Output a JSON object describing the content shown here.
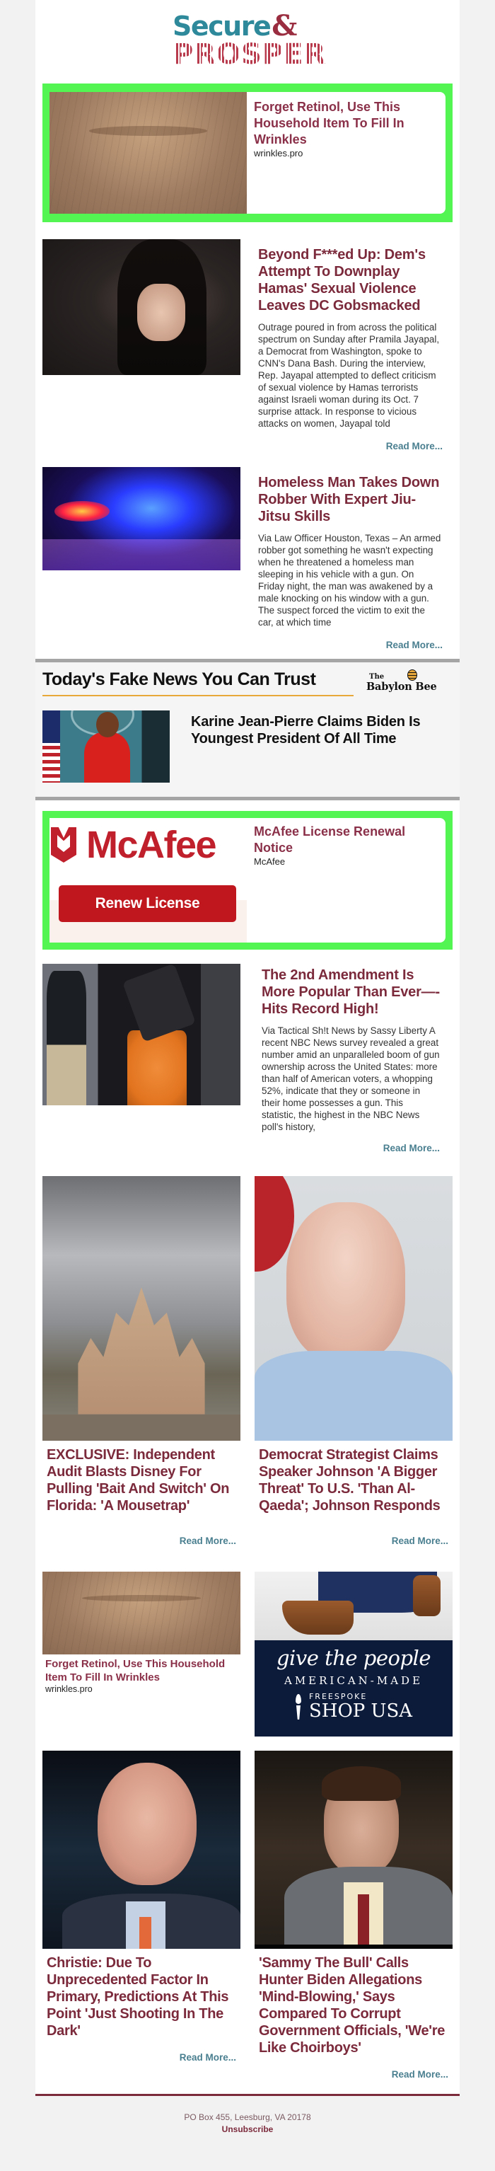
{
  "header": {
    "logo_top": "Secure",
    "logo_amp": "&",
    "logo_bottom": "PROSPER"
  },
  "ad_top": {
    "title": "Forget Retinol, Use This Household Item To Fill In Wrinkles",
    "source": "wrinkles.pro"
  },
  "articles": [
    {
      "title": "Beyond F***ed Up: Dem's Attempt To Downplay Hamas' Sexual Violence Leaves DC Gobsmacked",
      "excerpt": "Outrage poured in from across the political spectrum on Sunday after Pramila Jayapal, a Democrat from Washington, spoke to CNN's Dana Bash. During the interview, Rep. Jayapal attempted to deflect criticism of sexual violence by Hamas terrorists against Israeli woman during its Oct. 7 surprise attack. In response to vicious attacks on women, Jayapal told",
      "read_more": "Read More..."
    },
    {
      "title": "Homeless Man Takes Down Robber With Expert Jiu-Jitsu Skills",
      "excerpt": "Via Law Officer Houston, Texas – An armed robber got something he wasn't expecting when he threatened a homeless man sleeping in his vehicle with a gun. On Friday night, the man was awakened by a male knocking on his window with a gun. The suspect forced the victim to exit the car, at which time",
      "read_more": "Read More..."
    }
  ],
  "babylon_bee": {
    "section_title": "Today's Fake News You Can Trust",
    "logo_the": "The",
    "logo_name": "Babylon Bee",
    "story_title": "Karine Jean-Pierre Claims Biden Is Youngest President Of All Time"
  },
  "ad_mcafee": {
    "logo_word": "McAfee",
    "button_label": "Renew License",
    "title": "McAfee License Renewal Notice",
    "source": "McAfee"
  },
  "article_gun": {
    "title": "The 2nd Amendment Is More Popular Than Ever—-Hits Record High!",
    "excerpt": "Via Tactical Sh!t News by Sassy Liberty A recent NBC News survey revealed a great number amid an unparalleled boom of gun ownership across the United States: more than half of American voters, a whopping 52%, indicate that they or someone in their home possesses a gun. This statistic, the highest in the NBC News poll's history,",
    "read_more": "Read More..."
  },
  "grid_1": [
    {
      "title": "EXCLUSIVE: Independent Audit Blasts Disney For Pulling 'Bait And Switch' On Florida: 'A Mousetrap'",
      "read_more": "Read More..."
    },
    {
      "title": "Democrat Strategist Claims Speaker Johnson 'A Bigger Threat' To U.S. 'Than Al-Qaeda'; Johnson Responds",
      "read_more": "Read More..."
    }
  ],
  "grid_ads": {
    "wrinkle": {
      "title": "Forget Retinol, Use This Household Item To Fill In Wrinkles",
      "source": "wrinkles.pro"
    },
    "freespoke": {
      "tagline": "give the people",
      "made": "AMERICAN-MADE",
      "brand_small": "FREESPOKE",
      "brand_large": "SHOP USA"
    }
  },
  "grid_2": [
    {
      "title": "Christie: Due To Unprecedented Factor In Primary, Predictions At This Point 'Just Shooting In The Dark'",
      "read_more": "Read More..."
    },
    {
      "title": "'Sammy The Bull' Calls Hunter Biden Allegations 'Mind-Blowing,' Says Compared To Corrupt Government Officials, 'We're Like Choirboys'",
      "read_more": "Read More..."
    }
  ],
  "footer": {
    "address": "PO Box 455, Leesburg, VA 20178",
    "unsubscribe": "Unsubscribe"
  },
  "colors": {
    "headline": "#7b2a3c",
    "read_more": "#4a7f90",
    "ad_border": "#52f552",
    "brand_teal": "#2e8a9a",
    "brand_red": "#9a2e40",
    "bee_underline": "#e9a83a",
    "mcafee_red": "#c0161e",
    "freespoke_navy": "#0d1b3a"
  }
}
